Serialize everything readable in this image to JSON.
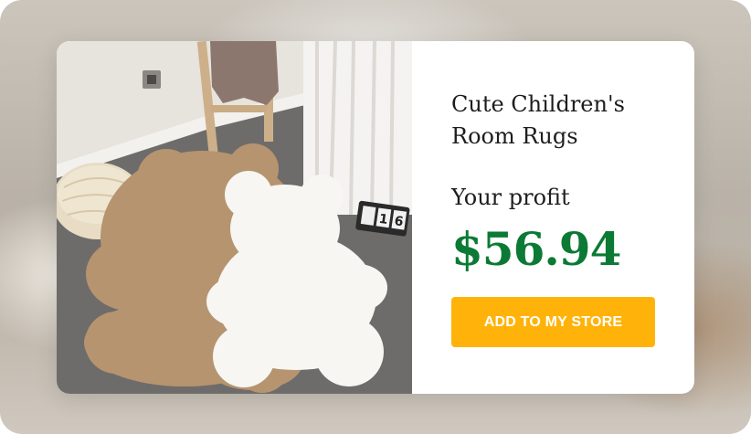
{
  "product": {
    "title": "Cute Children's Room Rugs",
    "profit_label": "Your profit",
    "price": "$56.94",
    "cta_label": "ADD TO MY STORE"
  },
  "photo": {
    "calendar_digits": [
      "1",
      "6"
    ],
    "colors": {
      "wall": "#e6e2dc",
      "carpet": "#6f6d6b",
      "brown_rug": "#b79574",
      "white_rug": "#f7f6f3",
      "pouf": "#e9dcc2"
    }
  },
  "colors": {
    "price_green": "#0b7a34",
    "button_yellow": "#ffb30a",
    "button_text": "#ffffff",
    "title_text": "#1d1d1d"
  }
}
